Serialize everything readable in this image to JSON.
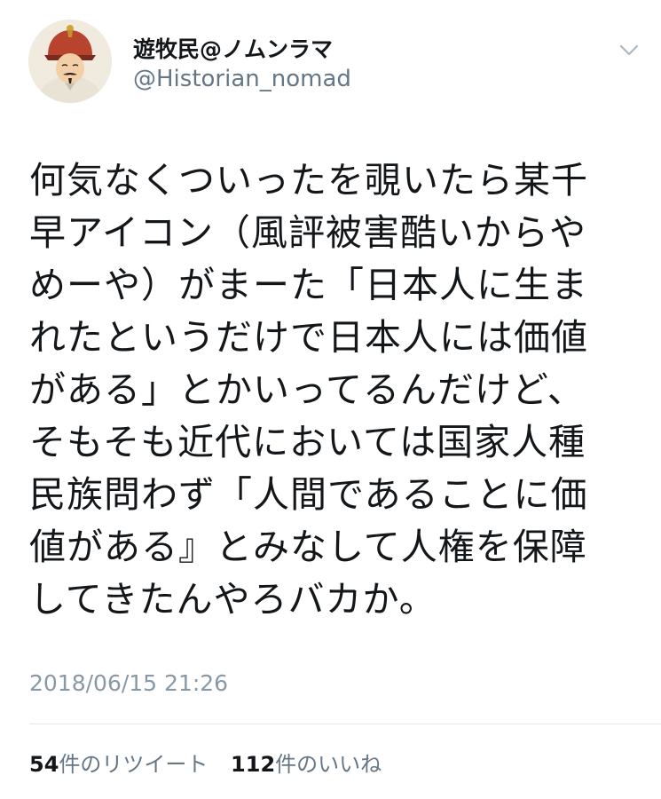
{
  "user": {
    "display_name": "遊牧民@ノムンラマ",
    "handle": "@Historian_nomad"
  },
  "tweet": {
    "lines": [
      "何気なくついったを覗いたら某千",
      "早アイコン（風評被害酷いからや",
      "めーや）がまーた「日本人に生ま",
      "れたというだけで日本人には価値",
      "がある」とかいってるんだけど、",
      "そもそも近代においては国家人種",
      "民族問わず「人間であることに価",
      "値がある』とみなして人権を保障",
      "してきたんやろバカか。"
    ],
    "timestamp": "2018/06/15 21:26"
  },
  "stats": {
    "retweet_count": "54",
    "retweet_label": "件のリツイート",
    "like_count": "112",
    "like_label": "件のいいね"
  },
  "icons": {
    "menu": "chevron-down-icon"
  },
  "colors": {
    "text": "#14171a",
    "secondary": "#657786",
    "timestamp": "#8899a6",
    "divider": "#e1e8ed"
  }
}
